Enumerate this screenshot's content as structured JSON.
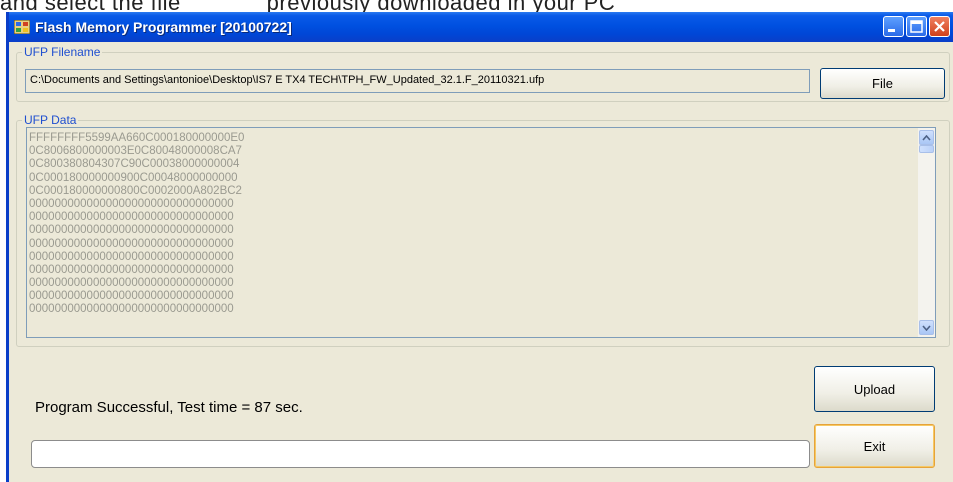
{
  "background_doc_text": "and select the file             previously downloaded in your PC",
  "window": {
    "title": "Flash Memory Programmer [20100722]",
    "controls": [
      "minimize-icon",
      "maximize-icon",
      "close-icon"
    ]
  },
  "ufp_filename": {
    "legend": "UFP Filename",
    "value": "C:\\Documents and Settings\\antonioe\\Desktop\\IS7 E TX4 TECH\\TPH_FW_Updated_32.1.F_20110321.ufp",
    "file_button": "File"
  },
  "ufp_data": {
    "legend": "UFP Data",
    "lines": [
      "FFFFFFFF5599AA660C000180000000E0",
      "0C8006800000003E0C80048000008CA7",
      "0C800380804307C90C00038000000004",
      "0C000180000000900C00048000000000",
      "0C000180000000800C0002000A802BC2",
      "00000000000000000000000000000000",
      "00000000000000000000000000000000",
      "00000000000000000000000000000000",
      "00000000000000000000000000000000",
      "00000000000000000000000000000000",
      "00000000000000000000000000000000",
      "00000000000000000000000000000000",
      "00000000000000000000000000000000",
      "00000000000000000000000000000000"
    ]
  },
  "status": {
    "message": "Program Successful, Test time = 87 sec.",
    "progress": 0
  },
  "buttons": {
    "upload": "Upload",
    "exit": "Exit"
  },
  "colors": {
    "titlebar": "#0050e0",
    "window_bg": "#ece9d8",
    "legend_text": "#1f4fd0",
    "close_button": "#d0401c"
  }
}
